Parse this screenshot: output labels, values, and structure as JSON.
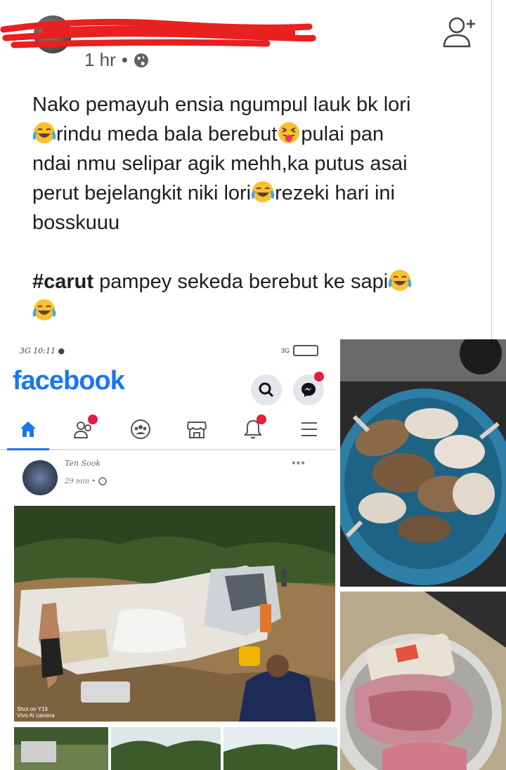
{
  "post": {
    "timestamp": "1 hr",
    "separator": "•",
    "text_lines": [
      "Nako pemayuh ensia ngumpul lauk bk lori",
      "rindu meda bala berebut",
      "pulai pan",
      "ndai nmu selipar agik mehh,ka putus asai",
      "perut bejelangkit niki lori",
      "rezeki hari ini",
      "bosskuuu"
    ],
    "hashtag": "#carut",
    "hashtag_rest": " pampey sekeda berebut ke sapi"
  },
  "icons": {
    "globe": "globe-icon",
    "add_friend": "add-friend-icon",
    "laugh": "tears-of-joy-emoji",
    "tongue": "squinting-tongue-emoji"
  },
  "screenshot": {
    "clock": "10:11",
    "net_left": "3G",
    "net_right": "3G",
    "app_name": "facebook",
    "inner_name": "Ten Sook",
    "inner_time": "29 min •",
    "watermark_line1": "Shot on Y19",
    "watermark_line2": "Vivo AI camera",
    "more": "•••"
  },
  "colors": {
    "facebook_blue": "#1877f2",
    "badge_red": "#e41e3f",
    "redaction_red": "#e8201f"
  }
}
